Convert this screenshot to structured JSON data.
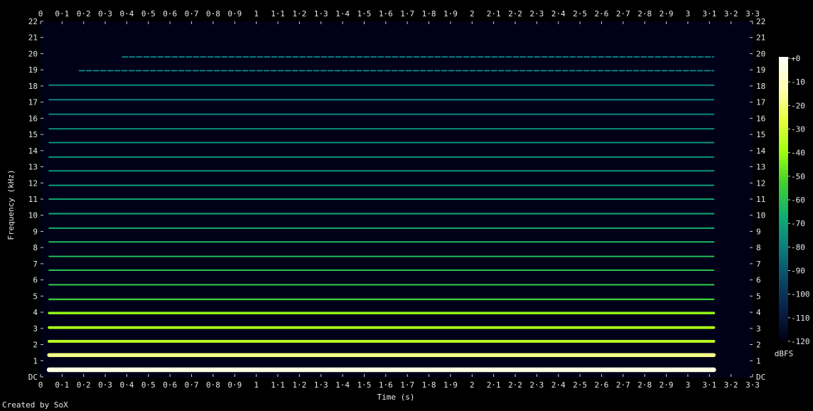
{
  "footer": {
    "credit": "Created by SoX"
  },
  "chart_data": {
    "type": "heatmap",
    "kind": "spectrogram",
    "xlabel": "Time (s)",
    "ylabel": "Frequency (kHz)",
    "x_tick_labels": [
      "0",
      "0·1",
      "0·2",
      "0·3",
      "0·4",
      "0·5",
      "0·6",
      "0·7",
      "0·8",
      "0·9",
      "1",
      "1·1",
      "1·2",
      "1·3",
      "1·4",
      "1·5",
      "1·6",
      "1·7",
      "1·8",
      "1·9",
      "2",
      "2·1",
      "2·2",
      "2·3",
      "2·4",
      "2·5",
      "2·6",
      "2·7",
      "2·8",
      "2·9",
      "3",
      "3·1",
      "3·2",
      "3·3"
    ],
    "y_tick_labels": [
      "DC",
      "1",
      "2",
      "3",
      "4",
      "5",
      "6",
      "7",
      "8",
      "9",
      "10",
      "11",
      "12",
      "13",
      "14",
      "15",
      "16",
      "17",
      "18",
      "19",
      "20",
      "21",
      "22"
    ],
    "xlim": [
      0,
      3.3
    ],
    "ylim": [
      0,
      22
    ],
    "colorbar": {
      "unit": "dBFS",
      "tick_labels": [
        "+0",
        "-10",
        "-20",
        "-30",
        "-40",
        "-50",
        "-60",
        "-70",
        "-80",
        "-90",
        "-100",
        "-110",
        "-120"
      ],
      "range": [
        -120,
        0
      ],
      "colors": [
        "#000010",
        "#08204a",
        "#0a4a6a",
        "#0a8080",
        "#10b070",
        "#40d030",
        "#a0ff10",
        "#e8ff40",
        "#ffffb0",
        "#ffffff"
      ]
    },
    "background_color": "#000018",
    "signal": {
      "start_s": 0.04,
      "end_s": 3.12
    },
    "harmonics": [
      {
        "freq_khz": 0.44,
        "level_db": -5
      },
      {
        "freq_khz": 1.35,
        "level_db": -18
      },
      {
        "freq_khz": 2.2,
        "level_db": -35
      },
      {
        "freq_khz": 3.05,
        "level_db": -38
      },
      {
        "freq_khz": 3.95,
        "level_db": -42
      },
      {
        "freq_khz": 4.8,
        "level_db": -55
      },
      {
        "freq_khz": 5.7,
        "level_db": -58
      },
      {
        "freq_khz": 6.6,
        "level_db": -60
      },
      {
        "freq_khz": 7.45,
        "level_db": -62
      },
      {
        "freq_khz": 8.35,
        "level_db": -63
      },
      {
        "freq_khz": 9.2,
        "level_db": -66
      },
      {
        "freq_khz": 10.1,
        "level_db": -68
      },
      {
        "freq_khz": 11.0,
        "level_db": -70
      },
      {
        "freq_khz": 11.85,
        "level_db": -72
      },
      {
        "freq_khz": 12.75,
        "level_db": -73
      },
      {
        "freq_khz": 13.6,
        "level_db": -75
      },
      {
        "freq_khz": 14.5,
        "level_db": -76
      },
      {
        "freq_khz": 15.35,
        "level_db": -77
      },
      {
        "freq_khz": 16.25,
        "level_db": -78
      },
      {
        "freq_khz": 17.15,
        "level_db": -79
      },
      {
        "freq_khz": 18.05,
        "level_db": -78
      },
      {
        "freq_khz": 18.95,
        "level_db": -80,
        "start_s": 0.18
      },
      {
        "freq_khz": 19.8,
        "level_db": -82,
        "start_s": 0.38
      }
    ]
  }
}
